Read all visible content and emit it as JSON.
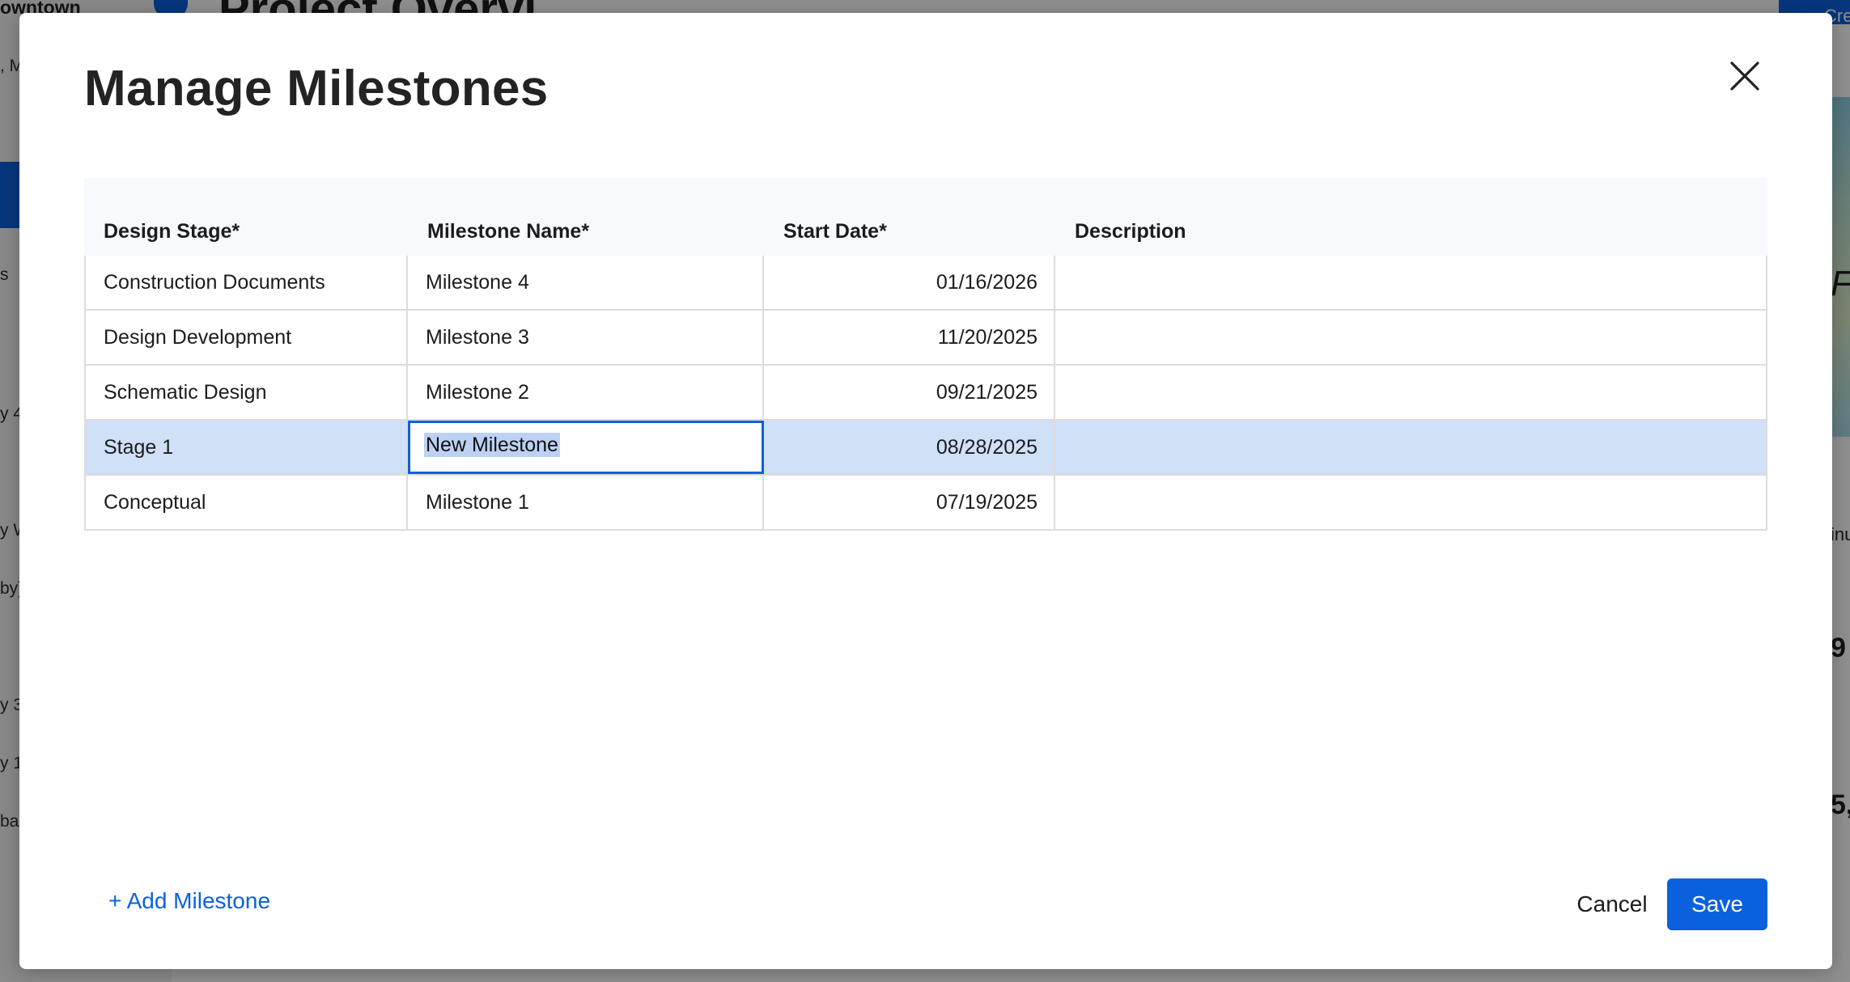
{
  "background": {
    "project_name": "owntown",
    "heading": "Project Overvi",
    "create_label": "Cre",
    "side_fragments": [
      ", M",
      "s",
      "y 4",
      "y W",
      "by)",
      "y 3",
      "y 1",
      "ba"
    ],
    "right_fragments": [
      "F",
      "inu",
      "9",
      "5,"
    ]
  },
  "modal": {
    "title": "Manage Milestones",
    "close_icon": "close-icon",
    "columns": [
      "Design Stage*",
      "Milestone Name*",
      "Start Date*",
      "Description"
    ],
    "rows": [
      {
        "stage": "Construction Documents",
        "milestone": "Milestone 4",
        "start_date": "01/16/2026",
        "description": "",
        "selected": false
      },
      {
        "stage": "Design Development",
        "milestone": "Milestone 3",
        "start_date": "11/20/2025",
        "description": "",
        "selected": false
      },
      {
        "stage": "Schematic Design",
        "milestone": "Milestone 2",
        "start_date": "09/21/2025",
        "description": "",
        "selected": false
      },
      {
        "stage": "Stage 1",
        "milestone": "New Milestone",
        "start_date": "08/28/2025",
        "description": "",
        "selected": true,
        "editing": "milestone"
      },
      {
        "stage": "Conceptual",
        "milestone": "Milestone 1",
        "start_date": "07/19/2025",
        "description": "",
        "selected": false
      }
    ],
    "add_label": "+ Add Milestone",
    "cancel_label": "Cancel",
    "save_label": "Save"
  },
  "colors": {
    "accent": "#0b61dd",
    "selected_row": "#cfe0f7",
    "header_bg": "#f7f9fd",
    "border": "#dcdcdc"
  }
}
